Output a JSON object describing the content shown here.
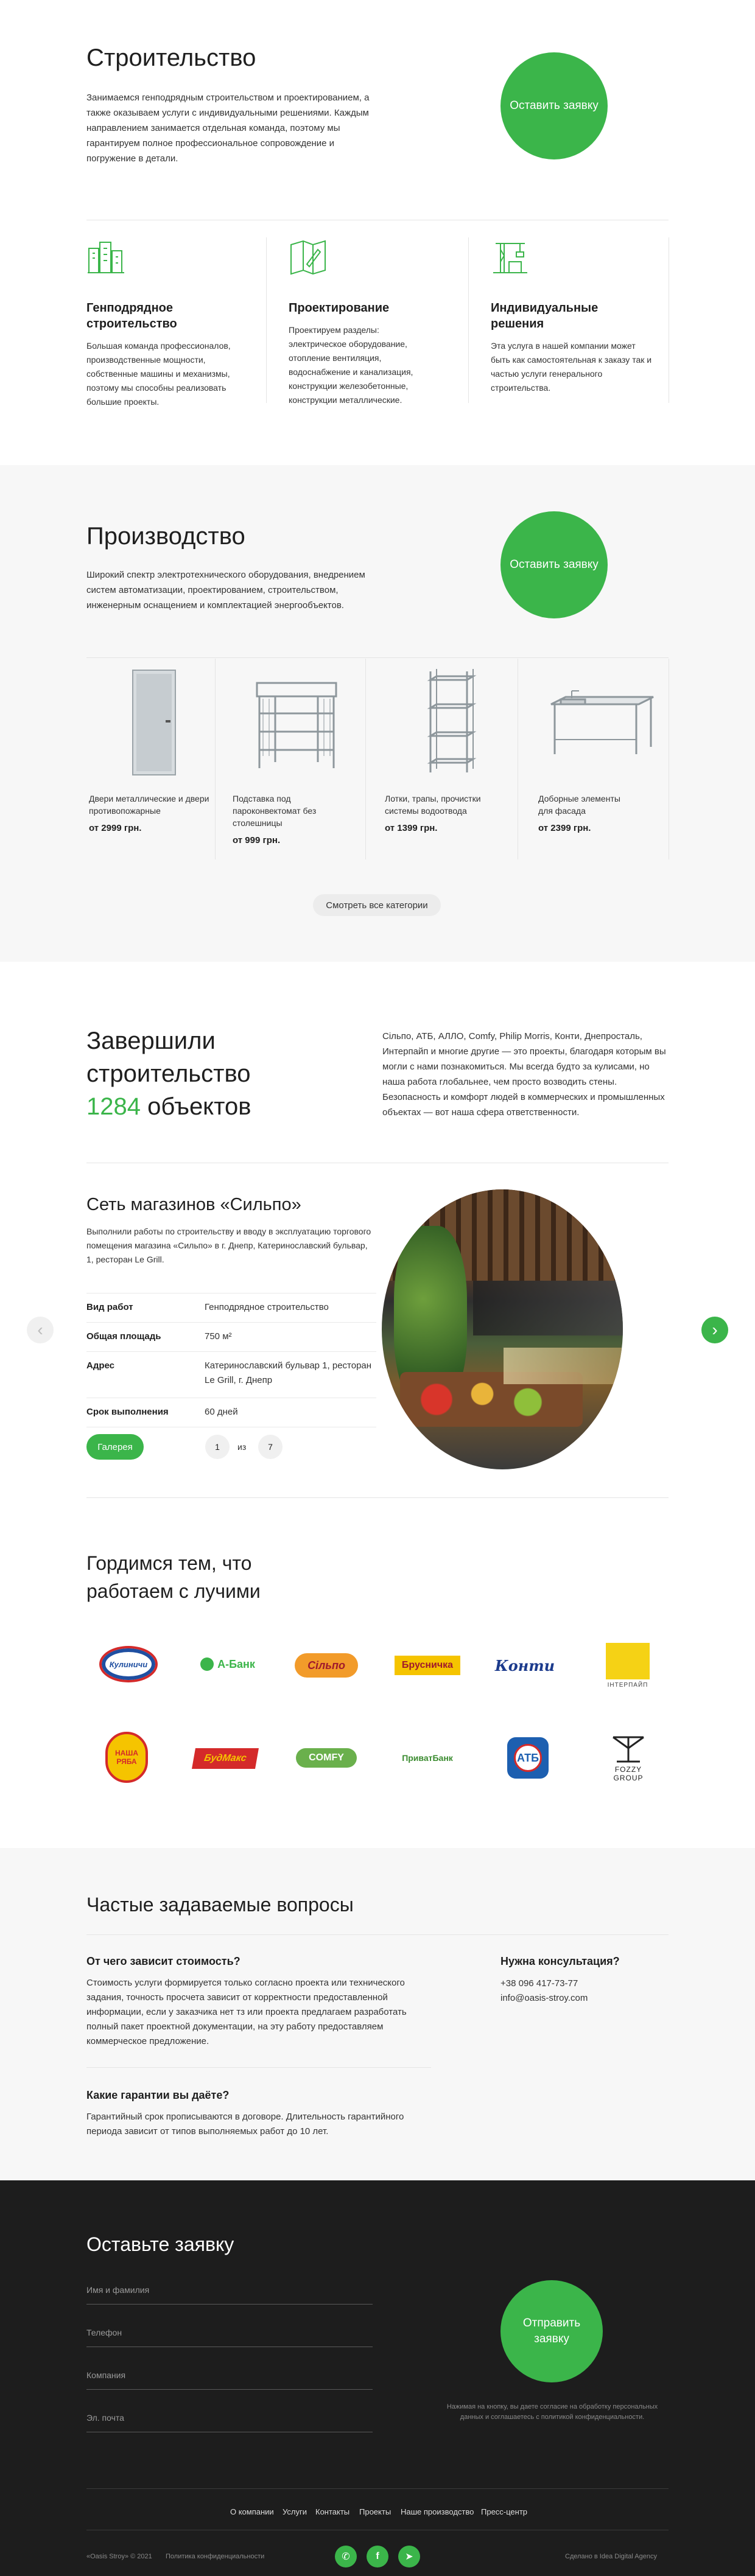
{
  "construction": {
    "title": "Строительство",
    "text": "Занимаемся генподрядным строительством и проектированием, а также оказываем услуги с индивидуальными решениями. Каждым направлением занимается отдельная команда, поэтому мы гарантируем полное профессиональное сопровождение и погружение в детали.",
    "cta": "Оставить заявку",
    "services": [
      {
        "title": "Генподрядное строительство",
        "text": "Большая команда профессионалов, производственные мощности, собственные машины и механизмы, поэтому мы способны реализовать большие проекты."
      },
      {
        "title": "Проектирование",
        "text": "Проектируем разделы: электрическое оборудование, отопление вентиляция, водоснабжение и канализация, конструкции железобетонные, конструкции металлические."
      },
      {
        "title": "Индивидуальные решения",
        "text": "Эта услуга в нашей компании может быть как самостоятельная к заказу так и частью услуги генерального строительства."
      }
    ]
  },
  "production": {
    "title": "Производство",
    "text": "Широкий спектр электротехнического оборудования, внедрением систем автоматизации, проектированием, строительством, инженерным оснащением и комплектацией энергообъектов.",
    "cta": "Оставить заявку",
    "products": [
      {
        "name": "Двери металлические и двери противопожарные",
        "price": "от 2999 грн."
      },
      {
        "name": "Подставка под пароконвектомат без столешницы",
        "price": "от 999 грн."
      },
      {
        "name": "Лотки, трапы, прочистки системы водоотвода",
        "price": "от 1399 грн."
      },
      {
        "name": "Доборные элементы для фасада",
        "price": "от 2399 грн."
      }
    ],
    "all_categories": "Смотреть все категории"
  },
  "completed": {
    "title_line1": "Завершили",
    "title_line2": "строительство",
    "count": "1284",
    "count_suffix": "объектов",
    "text": "Сільпо, АТБ, АЛЛО, Comfy, Philip Morris, Конти, Днепросталь, Интерпайп и многие другие — это проекты, благодаря которым вы могли с нами познакомиться. Мы всегда будто за кулисами, но наша работа глобальнее, чем просто возводить стены. Безопасность и комфорт людей в коммерческих и промышленных объектах — вот наша сфера ответственности."
  },
  "project": {
    "title": "Сеть магазинов «Сильпо»",
    "text": "Выполнили работы по строительству и вводу в эксплуатацию торгового помещения магазина «Сильпо» в г. Днепр, Катеринославский бульвар, 1, ресторан Le Grill.",
    "rows": [
      {
        "k": "Вид работ",
        "v": "Генподрядное строительство"
      },
      {
        "k": "Общая площадь",
        "v": "750 м²"
      },
      {
        "k": "Адрес",
        "v": "Катеринославский бульвар 1, ресторан Le Grill, г. Днепр"
      },
      {
        "k": "Срок выполнения",
        "v": "60 дней"
      }
    ],
    "gallery": "Галерея",
    "page_current": "1",
    "page_of": "из",
    "page_total": "7",
    "prev": "‹",
    "next": "›"
  },
  "partners": {
    "title_line1": "Гордимся тем, что",
    "title_line2": "работаем с лучими",
    "logos": [
      "Кулиничи",
      "А-Банк",
      "Сільпо",
      "Брусничка",
      "Конти",
      "ІНТЕРПАЙП",
      "НАША РЯБА",
      "БудМакс",
      "COMFY",
      "ПриватБанк",
      "АТБ",
      "FOZZY GROUP"
    ]
  },
  "faq": {
    "title": "Частые задаваемые вопросы",
    "items": [
      {
        "q": "От чего зависит стоимость?",
        "a": "Стоимость услуги формируется только согласно проекта или технического задания, точность просчета зависит от корректности предоставленной информации, если у заказчика нет тз или проекта предлагаем разработать полный пакет проектной документации, на эту работу предоставляем коммерческое предложение."
      },
      {
        "q": "Какие гарантии вы даёте?",
        "a": "Гарантийный срок прописываются в договоре. Длительность гарантийного периода зависит от типов выполняемых работ до 10 лет."
      }
    ],
    "consult_title": "Нужна консультация?",
    "phone": "+38 096 417-73-77",
    "email": "info@oasis-stroy.com"
  },
  "form": {
    "title": "Оставьте заявку",
    "name_ph": "Имя и фамилия",
    "phone_ph": "Телефон",
    "company_ph": "Компания",
    "email_ph": "Эл. почта",
    "submit": "Отправить заявку",
    "consent": "Нажимая на кнопку, вы даете согласие на обработку персональных данных и соглашаетесь с политикой конфиденциальности."
  },
  "footer": {
    "nav": [
      "О компании",
      "Услуги",
      "Контакты",
      "Проекты",
      "Наше производство",
      "Пресс-центр"
    ],
    "copyright": "«Oasis Stroy» © 2021",
    "policy": "Политика конфиденциальности",
    "credit": "Сделано в Idea Digital Agency",
    "social": [
      "viber",
      "facebook",
      "telegram"
    ]
  },
  "colors": {
    "accent": "#3bb54a",
    "dark": "#1d1d1d",
    "light": "#f7f7f7"
  }
}
